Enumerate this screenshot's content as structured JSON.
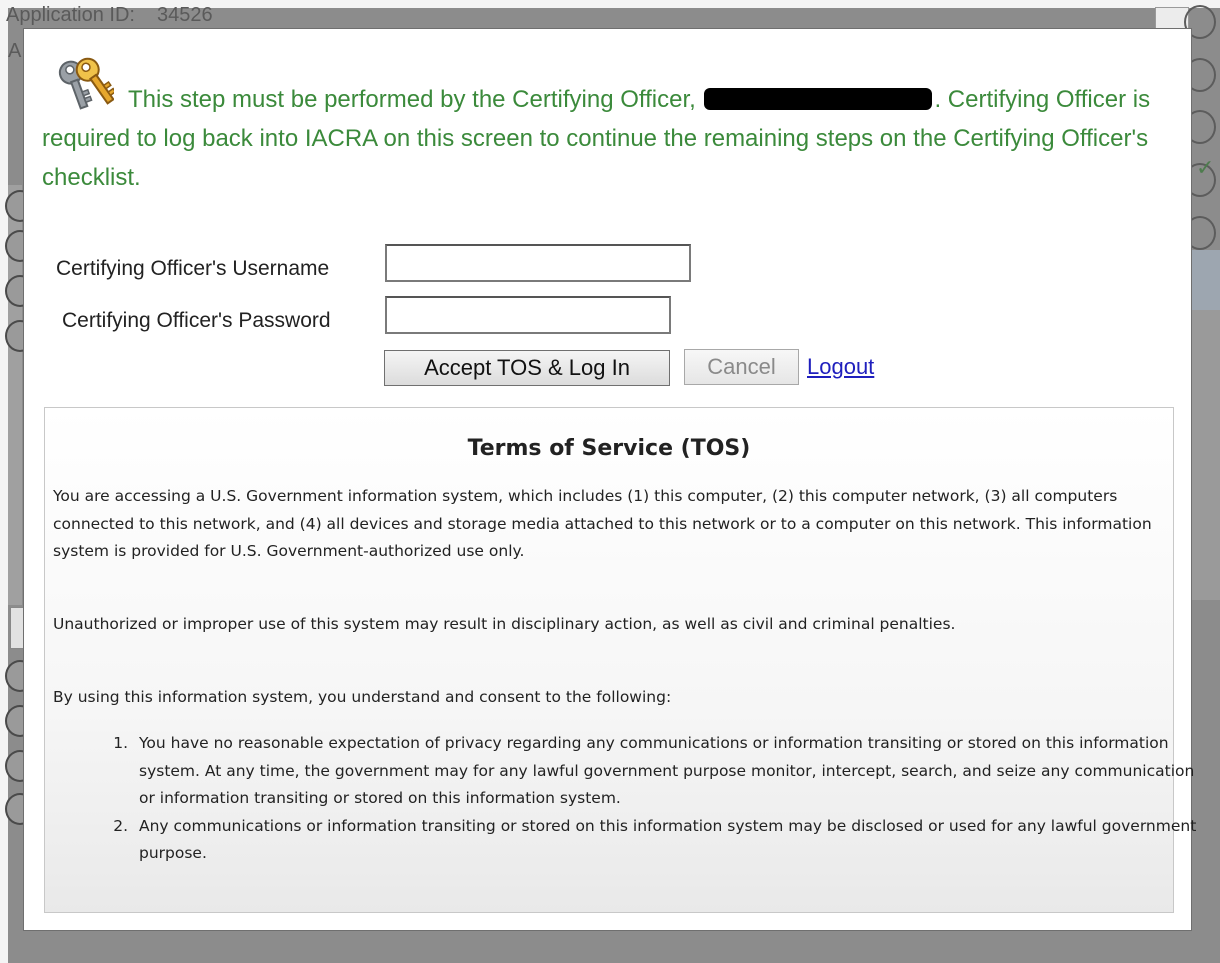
{
  "background": {
    "application_id_label": "Application ID:",
    "application_id_value": "34526",
    "partial_label": "A"
  },
  "modal": {
    "icon": "keys-icon",
    "notice": {
      "before": "This step must be performed by the Certifying Officer,",
      "after": ". Certifying Officer is required to log back into IACRA on this screen to continue the remaining steps on the Certifying Officer's checklist."
    },
    "form": {
      "username_label": "Certifying Officer's Username",
      "username_value": "",
      "password_label": "Certifying Officer's Password",
      "password_value": "",
      "accept_button": "Accept TOS & Log In",
      "cancel_button": "Cancel",
      "logout_link": "Logout"
    },
    "tos": {
      "title": "Terms of Service (TOS)",
      "paragraph1": "You are accessing a U.S. Government information system, which includes (1) this computer, (2) this computer network, (3) all computers connected to this network, and (4) all devices and storage media attached to this network or to a computer on this network. This information system is provided for U.S. Government-authorized use only.",
      "paragraph2": "Unauthorized or improper use of this system may result in disciplinary action, as well as civil and criminal penalties.",
      "paragraph3": "By using this information system, you understand and consent to the following:",
      "items": [
        "You have no reasonable expectation of privacy regarding any communications or information transiting or stored on this information system. At any time, the government may for any lawful government purpose monitor, intercept, search, and seize any communication or information transiting or stored on this information system.",
        "Any communications or information transiting or stored on this information system may be disclosed or used for any lawful government purpose."
      ]
    }
  },
  "colors": {
    "notice_text": "#3b8a3b",
    "link": "#1f1fbd",
    "overlay": "#8c8c8c"
  }
}
